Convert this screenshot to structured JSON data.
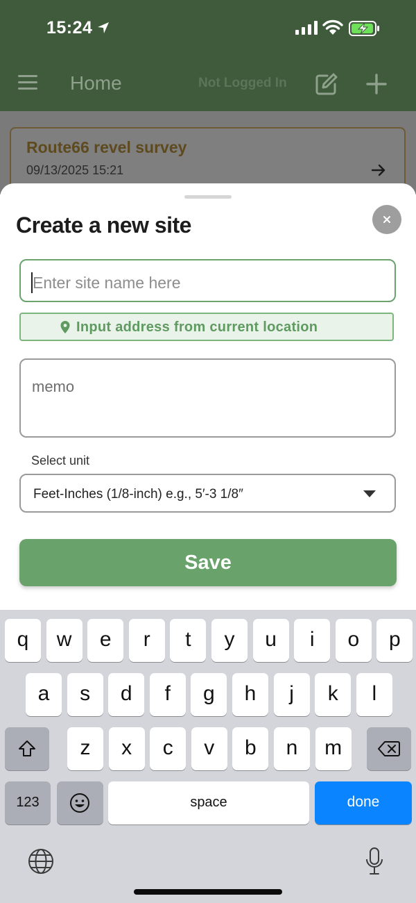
{
  "status_bar": {
    "time": "15:24"
  },
  "header": {
    "title": "Home",
    "login_status": "Not Logged In",
    "icons": {
      "menu": "hamburger-menu-icon",
      "edit": "edit-note-icon",
      "add": "plus-icon"
    }
  },
  "survey_card": {
    "title": "Route66 revel survey",
    "date": "09/13/2025 15:21"
  },
  "sheet": {
    "title": "Create a new site",
    "site_name": {
      "value": "",
      "placeholder": "Enter site name here"
    },
    "location_button": "Input address from current location",
    "memo": {
      "value": "",
      "placeholder": "memo"
    },
    "unit_label": "Select unit",
    "unit_selected": "Feet-Inches (1/8-inch) e.g., 5′-3 1/8″",
    "save_label": "Save"
  },
  "keyboard": {
    "row1": [
      "q",
      "w",
      "e",
      "r",
      "t",
      "y",
      "u",
      "i",
      "o",
      "p"
    ],
    "row2": [
      "a",
      "s",
      "d",
      "f",
      "g",
      "h",
      "j",
      "k",
      "l"
    ],
    "row3": [
      "z",
      "x",
      "c",
      "v",
      "b",
      "n",
      "m"
    ],
    "numbers_label": "123",
    "space_label": "space",
    "done_label": "done"
  },
  "colors": {
    "header_bg": "#3f5b3c",
    "accent_green": "#69a26a",
    "input_focus_border": "#6aa36c",
    "done_key": "#0a84ff"
  }
}
